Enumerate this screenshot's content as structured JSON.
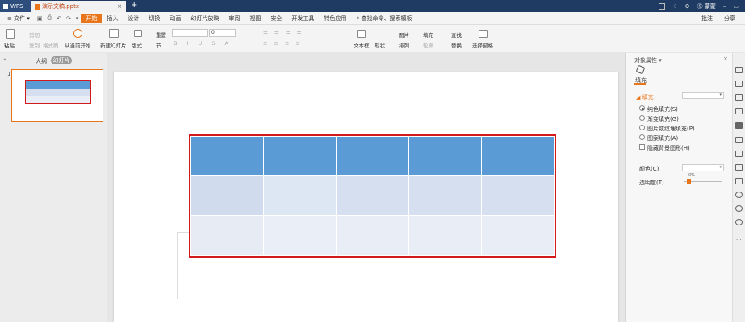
{
  "titlebar": {
    "app": "WPS",
    "doc_tab": "演示文稿.pptx",
    "close": "×",
    "new_tab": "+",
    "user": "Ⓢ 蒙蒙"
  },
  "menu": {
    "file": "文件",
    "quick_icons": [
      "undo-icon",
      "redo-icon",
      "print-icon",
      "save-icon"
    ],
    "items": [
      "开始",
      "插入",
      "设计",
      "切换",
      "动画",
      "幻灯片放映",
      "审阅",
      "视图",
      "安全",
      "开发工具",
      "特色应用"
    ],
    "active": "开始",
    "search": "查找命令、搜索模板",
    "right": [
      "批注",
      "分享"
    ]
  },
  "ribbon": {
    "paste": "粘贴",
    "cut": "剪切",
    "copy": "复制",
    "format_painter": "格式刷",
    "play_from_current": "从当前开始",
    "new_slide": "新建幻灯片",
    "layout": "版式",
    "reset": "重置",
    "section": "节",
    "font_size_value": "0",
    "textbox": "文本框",
    "shape": "形状",
    "picture": "图片",
    "fill": "填充",
    "arrange": "排列",
    "outline": "轮廓",
    "find": "查找",
    "replace": "替换",
    "select_pane": "选择窗格"
  },
  "left_panel": {
    "tab_outline": "大纲",
    "tab_slides": "幻灯片",
    "slide_number": "1",
    "collapse": "«"
  },
  "slide": {
    "table": {
      "rows": 3,
      "cols": 5,
      "header_color": "#5b9bd5",
      "row2_color": "#d6dff0",
      "row3_color": "#e9edf6",
      "border_color": "#d21a1a"
    }
  },
  "right_panel": {
    "title": "对象属性",
    "tab": "填充",
    "section": "填充",
    "options": [
      {
        "label": "纯色填充(S)",
        "selected": true
      },
      {
        "label": "渐变填充(G)",
        "selected": false
      },
      {
        "label": "图片或纹理填充(P)",
        "selected": false
      },
      {
        "label": "图案填充(A)",
        "selected": false
      }
    ],
    "hide_bg": "隐藏背景图形(H)",
    "color_label": "颜色(C)",
    "transparency_label": "透明度(T)",
    "transparency_value": "0%",
    "close": "×"
  },
  "colors": {
    "accent": "#e8751a",
    "titlebar": "#1f3b63",
    "selection": "#d21a1a"
  }
}
